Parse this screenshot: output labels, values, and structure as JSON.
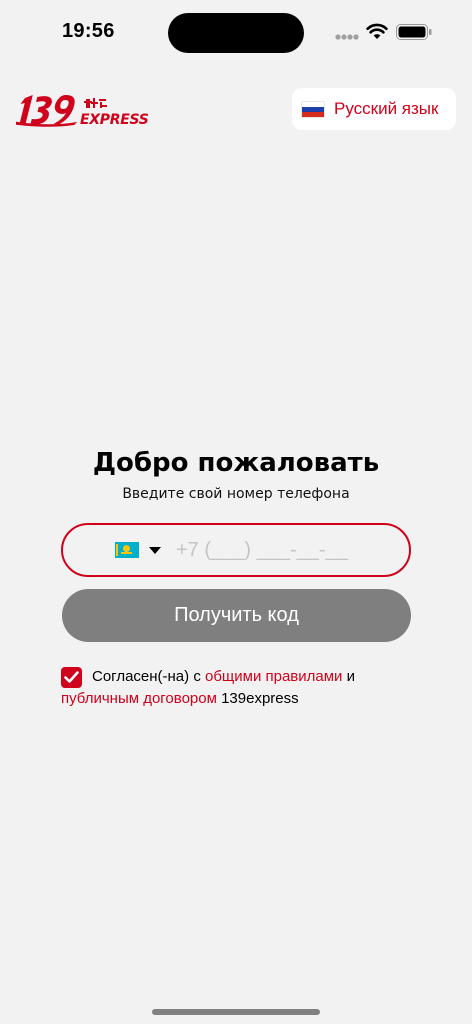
{
  "status_bar": {
    "time": "19:56"
  },
  "header": {
    "logo_icon": "139-express-logo",
    "language_button": {
      "label": "Русский язык",
      "flag_icon": "russia-flag-icon"
    }
  },
  "welcome": {
    "title": "Добро пожаловать",
    "subtitle": "Введите свой номер телефона"
  },
  "phone_field": {
    "country_flag_icon": "kazakhstan-flag-icon",
    "value": "",
    "placeholder": "+7 (___) ___-__-__"
  },
  "get_code_button": {
    "label": "Получить код"
  },
  "agreement": {
    "checked": true,
    "text_before": "Согласен(-на) с ",
    "rules_link": "общими правилами",
    "text_middle": " и ",
    "contract_link": "публичным договором",
    "text_after": " 139express"
  },
  "colors": {
    "accent": "#d0021b",
    "background": "#f2f2f2",
    "button_disabled": "#7f7f7f",
    "placeholder": "#c4c4c4"
  }
}
